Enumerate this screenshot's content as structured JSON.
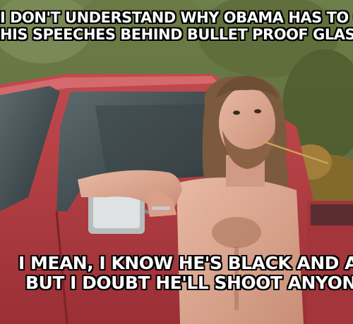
{
  "meme": {
    "top_text": [
      "I DON'T UNDERSTAND WHY OBAMA HAS TO GIVE",
      "HIS SPEECHES BEHIND BULLET PROOF GLASS."
    ],
    "bottom_text": [
      "I MEAN, I KNOW HE'S BLACK AND ALL,",
      "BUT I DOUBT HE'LL SHOOT ANYONE."
    ]
  }
}
